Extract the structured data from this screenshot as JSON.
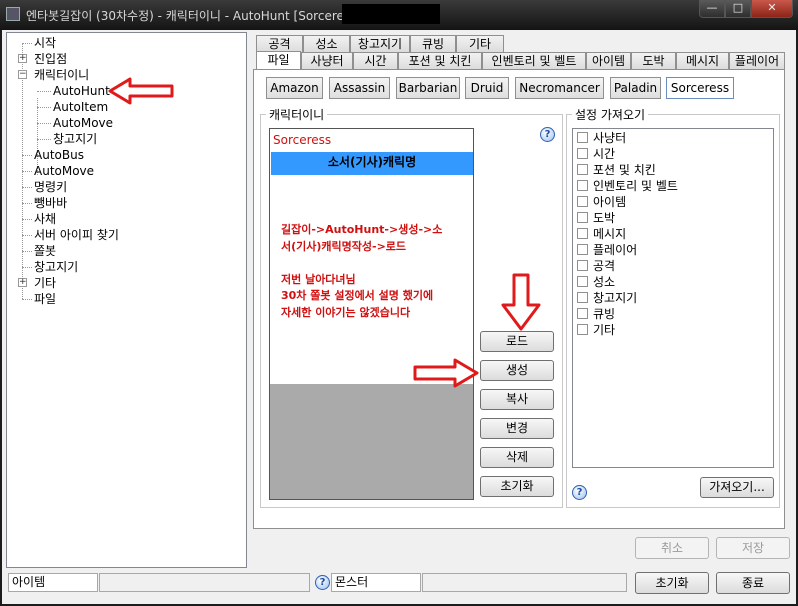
{
  "window": {
    "title": "엔타봇길잡이 (30차수정) - 캐릭터이니 - AutoHunt [Sorceress:",
    "min_glyph": "—",
    "max_glyph": "□",
    "close_glyph": "✕"
  },
  "tree": {
    "items": [
      {
        "label": "시작",
        "expand": ""
      },
      {
        "label": "진입점",
        "expand": "+"
      },
      {
        "label": "캐릭터이니",
        "expand": "−"
      },
      {
        "label": "AutoHunt",
        "expand": ""
      },
      {
        "label": "AutoItem",
        "expand": ""
      },
      {
        "label": "AutoMove",
        "expand": ""
      },
      {
        "label": "창고지기",
        "expand": ""
      },
      {
        "label": "AutoBus",
        "expand": ""
      },
      {
        "label": "AutoMove",
        "expand": ""
      },
      {
        "label": "명령키",
        "expand": ""
      },
      {
        "label": "뺑바바",
        "expand": ""
      },
      {
        "label": "사채",
        "expand": ""
      },
      {
        "label": "서버 아이피 찾기",
        "expand": ""
      },
      {
        "label": "쫄봇",
        "expand": ""
      },
      {
        "label": "창고지기",
        "expand": ""
      },
      {
        "label": "기타",
        "expand": "+"
      },
      {
        "label": "파일",
        "expand": ""
      }
    ]
  },
  "tabs": {
    "row1": [
      "공격",
      "성소",
      "창고지기",
      "큐빙",
      "기타"
    ],
    "row2": [
      "파일",
      "사냥터",
      "시간",
      "포션 및 치킨",
      "인벤토리 및 벨트",
      "아이템",
      "도박",
      "메시지",
      "플레이어"
    ],
    "active": "파일"
  },
  "subtabs": {
    "items": [
      "Amazon",
      "Assassin",
      "Barbarian",
      "Druid",
      "Necromancer",
      "Paladin",
      "Sorceress"
    ],
    "active": "Sorceress"
  },
  "char_group": {
    "title": "캐릭터이니",
    "help": "?",
    "list_title": "Sorceress",
    "selected_item": "소서(기사)캐릭명",
    "note_lines": [
      "길잡이->AutoHunt->생성->소",
      "서(기사)캐릭명작성->로드",
      "",
      "저번 날아다녀님",
      "30차 쫄봇 설정에서 설명 했기에",
      "자세한 이야기는 않겠습니다"
    ],
    "buttons": [
      "로드",
      "생성",
      "복사",
      "변경",
      "삭제",
      "초기화"
    ]
  },
  "settings_group": {
    "title": "설정 가져오기",
    "items": [
      "사냥터",
      "시간",
      "포션 및 치킨",
      "인벤토리 및 벨트",
      "아이템",
      "도박",
      "메시지",
      "플레이어",
      "공격",
      "성소",
      "창고지기",
      "큐빙",
      "기타"
    ],
    "help": "?",
    "import_button": "가져오기..."
  },
  "dialog_buttons": {
    "cancel": "취소",
    "save": "저장"
  },
  "status": {
    "left_label": "아이템",
    "help": "?",
    "monster_label": "몬스터",
    "reset_button": "초기화",
    "exit_button": "종료"
  },
  "colors": {
    "annotation_red": "#e01a1a",
    "list_selection": "#3399ff",
    "note_text": "#d01010"
  }
}
